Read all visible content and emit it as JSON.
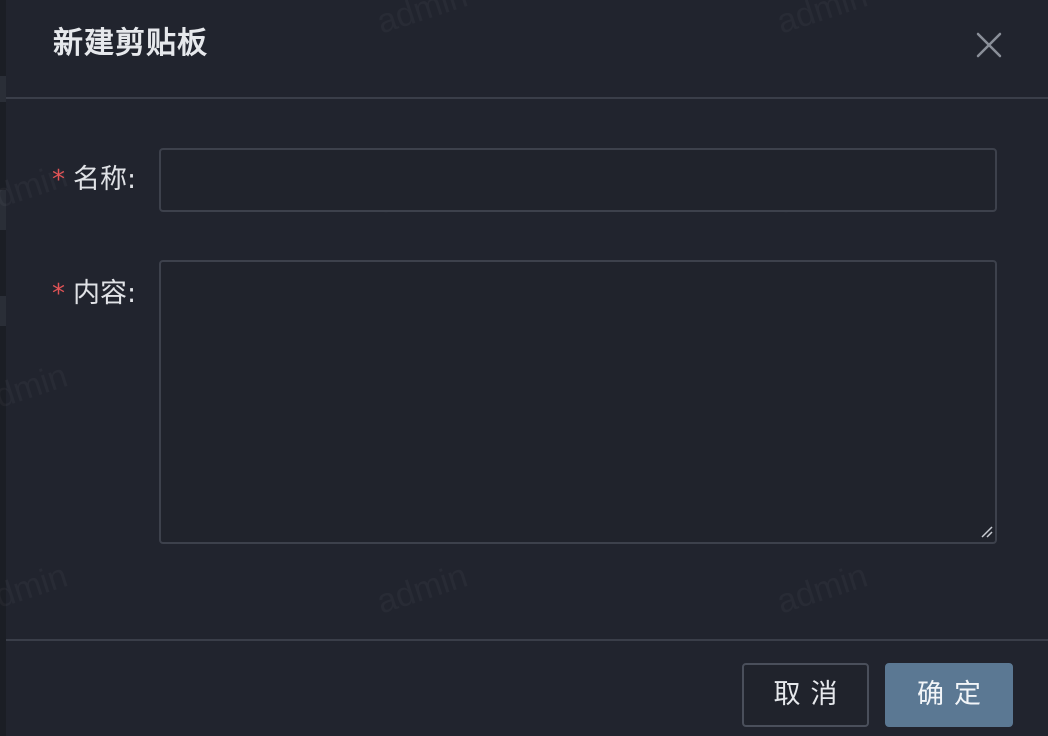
{
  "dialog": {
    "title": "新建剪贴板",
    "close_icon": "close-icon",
    "fields": {
      "name": {
        "required_mark": "*",
        "label": "名称:",
        "value": "",
        "placeholder": ""
      },
      "content": {
        "required_mark": "*",
        "label": "内容:",
        "value": "",
        "placeholder": ""
      }
    },
    "footer": {
      "cancel_label": "取消",
      "ok_label": "确定"
    }
  },
  "watermark": {
    "text": "admin"
  },
  "colors": {
    "background": "#21242e",
    "primary_button": "#5b7893",
    "required_star": "#e05356",
    "border": "#3d414c"
  }
}
